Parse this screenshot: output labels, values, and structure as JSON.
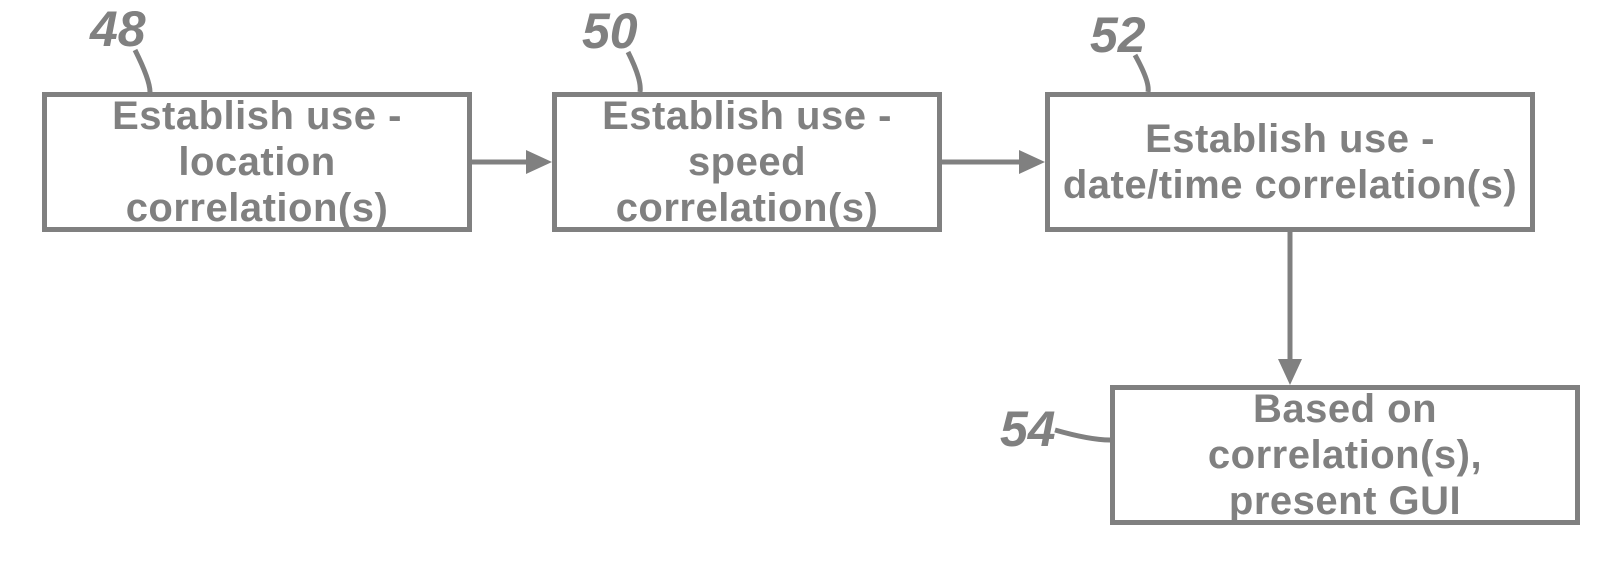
{
  "refs": {
    "r48": "48",
    "r50": "50",
    "r52": "52",
    "r54": "54"
  },
  "nodes": {
    "n48": {
      "line1": "Establish use -",
      "line2": "location correlation(s)"
    },
    "n50": {
      "line1": "Establish use -",
      "line2": "speed correlation(s)"
    },
    "n52": {
      "line1": "Establish use -",
      "line2": "date/time correlation(s)"
    },
    "n54": {
      "line1": "Based on correlation(s),",
      "line2": "present GUI"
    }
  }
}
